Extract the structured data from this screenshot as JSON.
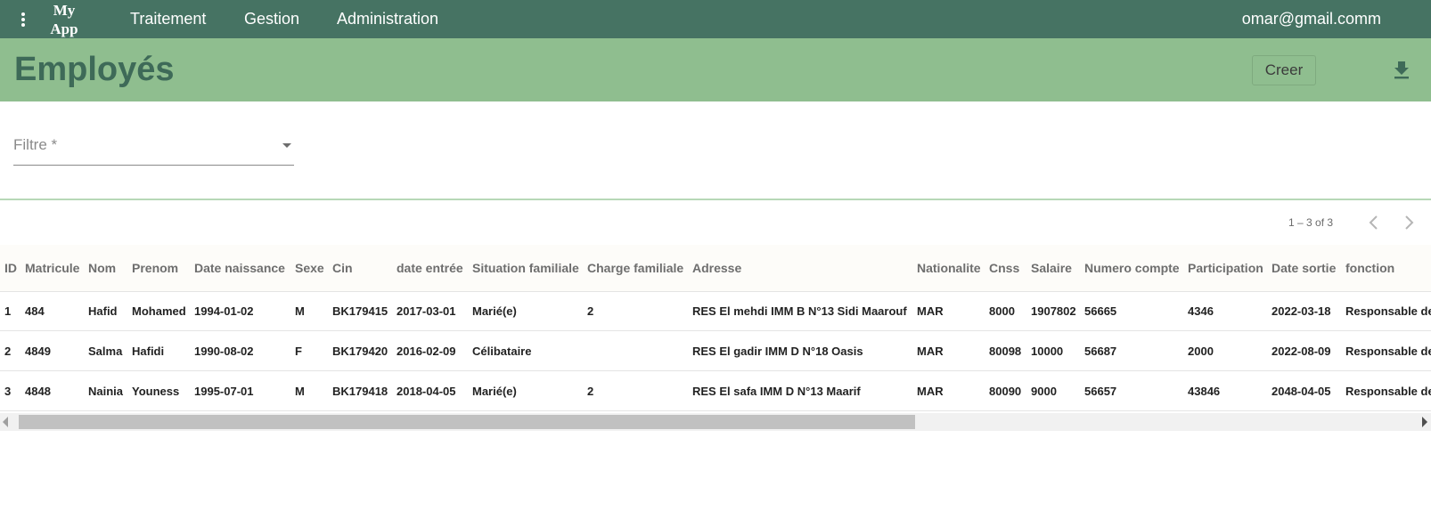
{
  "topbar": {
    "brand": "My App",
    "nav": [
      "Traitement",
      "Gestion",
      "Administration"
    ],
    "user_email": "omar@gmail.comm"
  },
  "header": {
    "title": "Employés",
    "create_label": "Creer"
  },
  "filter": {
    "label": "Filtre *"
  },
  "pagination": {
    "range": "1 – 3 of 3"
  },
  "table": {
    "columns": [
      "ID",
      "Matricule",
      "Nom",
      "Prenom",
      "Date naissance",
      "Sexe",
      "Cin",
      "date entrée",
      "Situation familiale",
      "Charge familiale",
      "Adresse",
      "Nationalite",
      "Cnss",
      "Salaire",
      "Numero compte",
      "Participation",
      "Date sortie",
      "fonction"
    ],
    "rows": [
      [
        "1",
        "484",
        "Hafid",
        "Mohamed",
        "1994-01-02",
        "M",
        "BK179415",
        "2017-03-01",
        "Marié(e)",
        "2",
        "RES El mehdi IMM B N°13 Sidi Maarouf",
        "MAR",
        "8000",
        "1907802",
        "56665",
        "4346",
        "2022-03-18",
        "Responsable de"
      ],
      [
        "2",
        "4849",
        "Salma",
        "Hafidi",
        "1990-08-02",
        "F",
        "BK179420",
        "2016-02-09",
        "Célibataire",
        "",
        "RES El gadir IMM D N°18 Oasis",
        "MAR",
        "80098",
        "10000",
        "56687",
        "2000",
        "2022-08-09",
        "Responsable de"
      ],
      [
        "3",
        "4848",
        "Nainia",
        "Youness",
        "1995-07-01",
        "M",
        "BK179418",
        "2018-04-05",
        "Marié(e)",
        "2",
        "RES El safa IMM D N°13 Maarif",
        "MAR",
        "80090",
        "9000",
        "56657",
        "43846",
        "2048-04-05",
        "Responsable de"
      ]
    ]
  },
  "icons": {
    "menu": "more-vert-icon",
    "download": "download-icon",
    "prev": "chevron-left-icon",
    "next": "chevron-right-icon"
  },
  "colors": {
    "topbar": "#467363",
    "titlebar": "#8fbe8f",
    "title_text": "#3e6a58"
  }
}
